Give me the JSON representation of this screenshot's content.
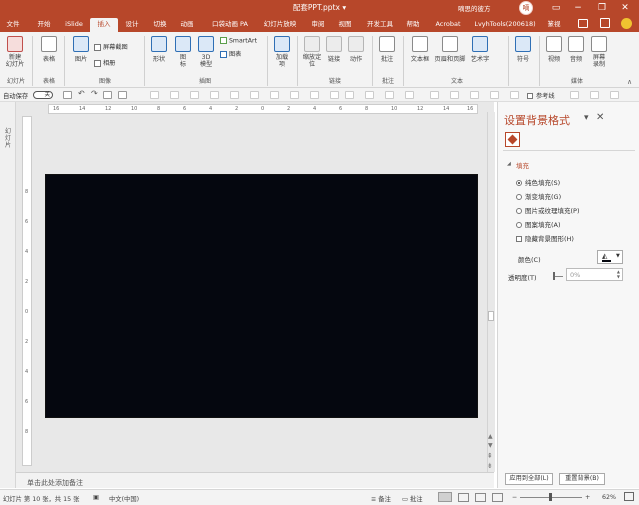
{
  "window": {
    "title": "配套PPT.pptx",
    "title_arrow": "▾",
    "user": "嘀思的彼方",
    "avatar_text": "嘀"
  },
  "tabs": [
    "文件",
    "开始",
    "iSlide",
    "插入",
    "设计",
    "切换",
    "动画",
    "口袋动画 PA",
    "幻灯片放映",
    "审阅",
    "视图",
    "开发工具",
    "帮助",
    "Acrobat",
    "LvyhTools(200618)",
    "篆视"
  ],
  "active_tab": "插入",
  "ribbon": {
    "new_slide": "新建\n幻灯片",
    "table": "表格",
    "picture": "图片",
    "screenshot": "屏幕截图",
    "album": "相册",
    "shapes": "形状",
    "icons": "图\n标",
    "model3d": "3D\n模型",
    "smartart": "SmartArt",
    "chart": "图表",
    "addins": "加载\n项",
    "zoom": "缩放定\n位",
    "link": "链接",
    "action": "动作",
    "comment": "批注",
    "textbox": "文本框",
    "header_footer": "页眉和页脚",
    "wordart": "艺术字",
    "symbol": "符号",
    "video": "视频",
    "audio": "音频",
    "screen_record": "屏幕\n录制",
    "groups": {
      "slides": "幻灯片",
      "tables": "表格",
      "images": "图像",
      "illustrations": "插图",
      "links": "链接",
      "comments": "批注",
      "text": "文本",
      "media": "媒体"
    }
  },
  "qat": {
    "autosave": "自动保存",
    "off": "关",
    "ref_line": "参考线"
  },
  "ruler": {
    "h": [
      "16",
      "14",
      "12",
      "10",
      "8",
      "6",
      "4",
      "2",
      "0",
      "2",
      "4",
      "6",
      "8",
      "10",
      "12",
      "14",
      "16"
    ],
    "v": [
      "8",
      "6",
      "4",
      "2",
      "0",
      "2",
      "4",
      "6",
      "8"
    ]
  },
  "left_pane_label": "幻灯片",
  "notes_placeholder": "单击此处添加备注",
  "format_pane": {
    "title": "设置背景格式",
    "fill_section": "填充",
    "options": [
      {
        "label": "纯色填充(S)",
        "checked": true
      },
      {
        "label": "渐变填充(G)",
        "checked": false
      },
      {
        "label": "图片或纹理填充(P)",
        "checked": false
      },
      {
        "label": "图案填充(A)",
        "checked": false
      }
    ],
    "hide_bg": "隐藏背景图形(H)",
    "color_label": "颜色(C)",
    "transparency_label": "透明度(T)",
    "transparency_value": "0%",
    "apply_all": "应用到全部(L)",
    "reset": "重置背景(B)"
  },
  "status": {
    "slide_info": "幻灯片 第 10 张，共 15 张",
    "lang": "中文(中国)",
    "notes": "备注",
    "comments": "批注",
    "zoom": "62%"
  }
}
